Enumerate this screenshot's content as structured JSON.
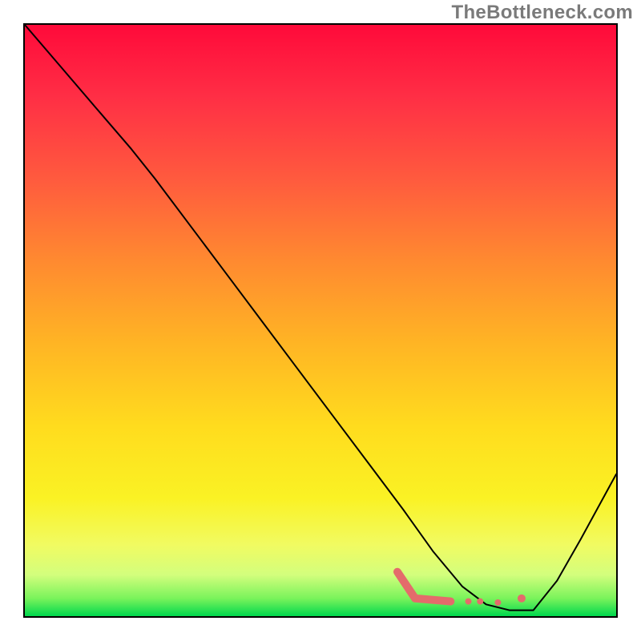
{
  "watermark": "TheBottleneck.com",
  "chart_data": {
    "type": "line",
    "title": "",
    "xlabel": "",
    "ylabel": "",
    "xlim": [
      0,
      100
    ],
    "ylim": [
      0,
      100
    ],
    "grid": false,
    "legend": false,
    "series": [
      {
        "name": "curve",
        "x": [
          0,
          6,
          12,
          18,
          22,
          28,
          34,
          40,
          46,
          52,
          58,
          64,
          69,
          74,
          78,
          82,
          86,
          90,
          94,
          100
        ],
        "y": [
          100,
          93,
          86,
          79,
          74,
          66,
          58,
          50,
          42,
          34,
          26,
          18,
          11,
          5,
          2,
          1,
          1,
          6,
          13,
          24
        ],
        "color": "#000000",
        "stroke_width": 2
      }
    ],
    "highlight": {
      "note": "small red marker segment near the valley floor",
      "color": "#e46b6b",
      "points_x": [
        63,
        66,
        72,
        75,
        77,
        80,
        84
      ],
      "points_y": [
        7.5,
        3.0,
        2.5,
        2.5,
        2.5,
        2.3,
        3.0
      ]
    },
    "gradient": {
      "orientation": "vertical-top-to-bottom",
      "stops": [
        {
          "pos": 0.0,
          "color": "#ff0a3a"
        },
        {
          "pos": 0.12,
          "color": "#ff2e45"
        },
        {
          "pos": 0.26,
          "color": "#ff5a3e"
        },
        {
          "pos": 0.4,
          "color": "#ff8a30"
        },
        {
          "pos": 0.54,
          "color": "#ffb524"
        },
        {
          "pos": 0.68,
          "color": "#ffdc1e"
        },
        {
          "pos": 0.8,
          "color": "#faf224"
        },
        {
          "pos": 0.88,
          "color": "#f1fb62"
        },
        {
          "pos": 0.93,
          "color": "#d3fe7d"
        },
        {
          "pos": 0.97,
          "color": "#7af35b"
        },
        {
          "pos": 1.0,
          "color": "#00d84e"
        }
      ]
    }
  }
}
